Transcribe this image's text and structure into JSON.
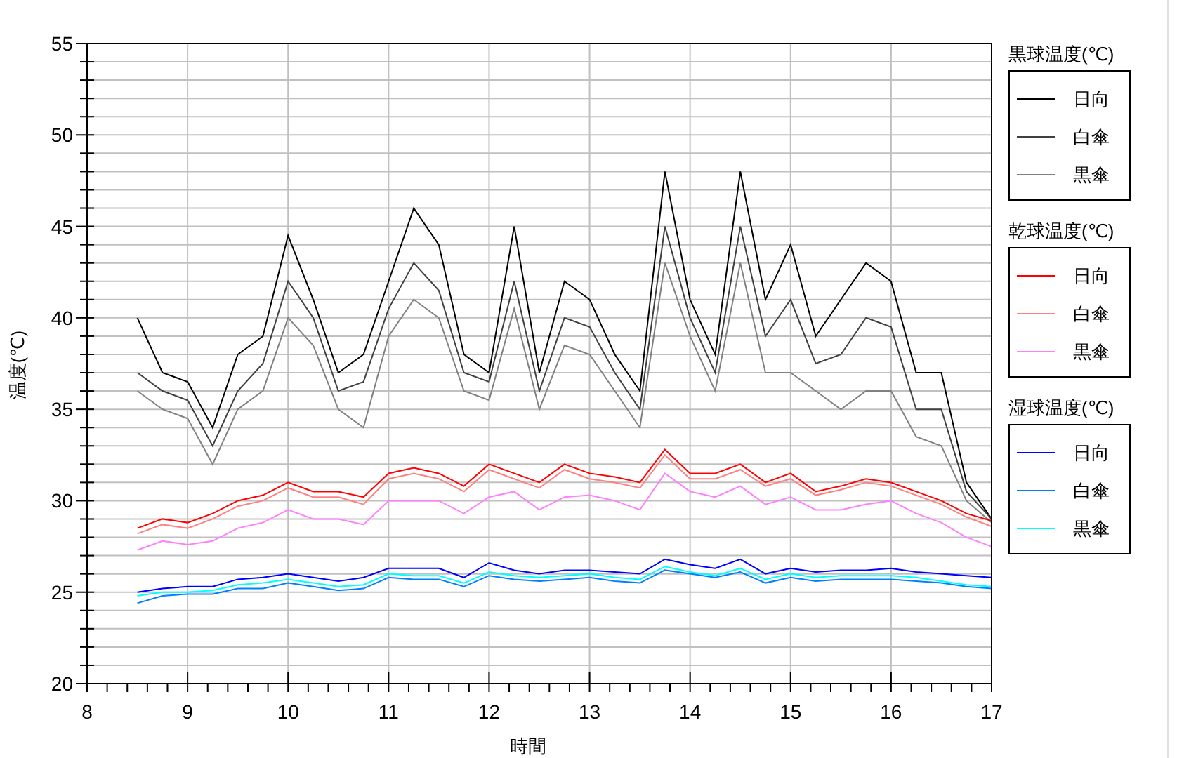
{
  "chart_data": {
    "type": "line",
    "grid": true,
    "xlabel": "時間",
    "ylabel": "温度(℃)",
    "xlim": [
      8,
      17
    ],
    "ylim": [
      20,
      55
    ],
    "xticks": [
      8,
      9,
      10,
      11,
      12,
      13,
      14,
      15,
      16,
      17
    ],
    "yticks": [
      20,
      25,
      30,
      35,
      40,
      45,
      50,
      55
    ],
    "x": [
      8.5,
      8.75,
      9,
      9.25,
      9.5,
      9.75,
      10,
      10.25,
      10.5,
      10.75,
      11,
      11.25,
      11.5,
      11.75,
      12,
      12.25,
      12.5,
      12.75,
      13,
      13.25,
      13.5,
      13.75,
      14,
      14.25,
      14.5,
      14.75,
      15,
      15.25,
      15.5,
      15.75,
      16,
      16.25,
      16.5,
      16.75,
      17
    ],
    "series": [
      {
        "name": "日向",
        "color": "#000000",
        "values": [
          40,
          37,
          36.5,
          34,
          38,
          39,
          44.5,
          41,
          37,
          38,
          42,
          46,
          44,
          38,
          37,
          45,
          37,
          42,
          41,
          38,
          36,
          48,
          41,
          38,
          48,
          41,
          44,
          39,
          41,
          43,
          42,
          37,
          37,
          31,
          29
        ]
      },
      {
        "name": "白傘",
        "color": "#404040",
        "values": [
          37,
          36,
          35.5,
          33,
          36,
          37.5,
          42,
          40,
          36,
          36.5,
          40.5,
          43,
          41.5,
          37,
          36.5,
          42,
          36,
          40,
          39.5,
          37,
          35,
          45,
          40,
          37,
          45,
          39,
          41,
          37.5,
          38,
          40,
          39.5,
          35,
          35,
          30.5,
          29
        ]
      },
      {
        "name": "黒傘",
        "color": "#808080",
        "values": [
          36,
          35,
          34.5,
          32,
          35,
          36,
          40,
          38.5,
          35,
          34,
          39,
          41,
          40,
          36,
          35.5,
          40.5,
          35,
          38.5,
          38,
          36,
          34,
          43,
          39,
          36,
          43,
          37,
          37,
          36,
          35,
          36,
          36,
          33.5,
          33,
          30,
          28.8
        ]
      },
      {
        "name": "日向",
        "color": "#ff0000",
        "values": [
          28.5,
          29,
          28.8,
          29.3,
          30,
          30.3,
          31,
          30.5,
          30.5,
          30.2,
          31.5,
          31.8,
          31.5,
          30.8,
          32,
          31.5,
          31,
          32,
          31.5,
          31.3,
          31,
          32.8,
          31.5,
          31.5,
          32,
          31,
          31.5,
          30.5,
          30.8,
          31.2,
          31,
          30.5,
          30,
          29.3,
          28.9
        ]
      },
      {
        "name": "白傘",
        "color": "#ff8080",
        "values": [
          28.2,
          28.7,
          28.5,
          29,
          29.7,
          30,
          30.7,
          30.2,
          30.2,
          29.8,
          31.2,
          31.5,
          31.2,
          30.5,
          31.7,
          31.2,
          30.7,
          31.7,
          31.2,
          31,
          30.7,
          32.5,
          31.2,
          31.2,
          31.7,
          30.8,
          31.2,
          30.3,
          30.6,
          31,
          30.8,
          30.3,
          29.8,
          29.1,
          28.6
        ]
      },
      {
        "name": "黒傘",
        "color": "#ff80ff",
        "values": [
          27.3,
          27.8,
          27.6,
          27.8,
          28.5,
          28.8,
          29.5,
          29,
          29,
          28.7,
          30,
          30,
          30,
          29.3,
          30.2,
          30.5,
          29.5,
          30.2,
          30.3,
          30,
          29.5,
          31.5,
          30.5,
          30.2,
          30.8,
          29.8,
          30.2,
          29.5,
          29.5,
          29.8,
          30,
          29.3,
          28.8,
          28,
          27.5
        ]
      },
      {
        "name": "日向",
        "color": "#0000ff",
        "values": [
          25,
          25.2,
          25.3,
          25.3,
          25.7,
          25.8,
          26,
          25.8,
          25.6,
          25.8,
          26.3,
          26.3,
          26.3,
          25.8,
          26.6,
          26.2,
          26,
          26.2,
          26.2,
          26.1,
          26,
          26.8,
          26.5,
          26.3,
          26.8,
          26,
          26.3,
          26.1,
          26.2,
          26.2,
          26.3,
          26.1,
          26,
          25.9,
          25.8
        ]
      },
      {
        "name": "白傘",
        "color": "#0080ff",
        "values": [
          24.4,
          24.8,
          24.9,
          24.9,
          25.2,
          25.2,
          25.5,
          25.3,
          25.1,
          25.2,
          25.8,
          25.7,
          25.7,
          25.3,
          25.9,
          25.7,
          25.6,
          25.7,
          25.8,
          25.6,
          25.5,
          26.2,
          26,
          25.8,
          26.1,
          25.5,
          25.8,
          25.6,
          25.7,
          25.7,
          25.7,
          25.6,
          25.5,
          25.3,
          25.2
        ]
      },
      {
        "name": "黒傘",
        "color": "#00ffff",
        "values": [
          24.8,
          25,
          25,
          25.1,
          25.4,
          25.5,
          25.7,
          25.5,
          25.3,
          25.4,
          26,
          25.9,
          25.9,
          25.5,
          26.1,
          25.9,
          25.8,
          25.9,
          26,
          25.8,
          25.7,
          26.4,
          26.1,
          25.9,
          26.3,
          25.7,
          26,
          25.8,
          25.9,
          25.9,
          25.9,
          25.8,
          25.6,
          25.4,
          25.3
        ]
      }
    ]
  },
  "legend": [
    {
      "title": "黒球温度(℃)"
    },
    {
      "title": "乾球温度(℃)"
    },
    {
      "title": "湿球温度(℃)"
    }
  ]
}
